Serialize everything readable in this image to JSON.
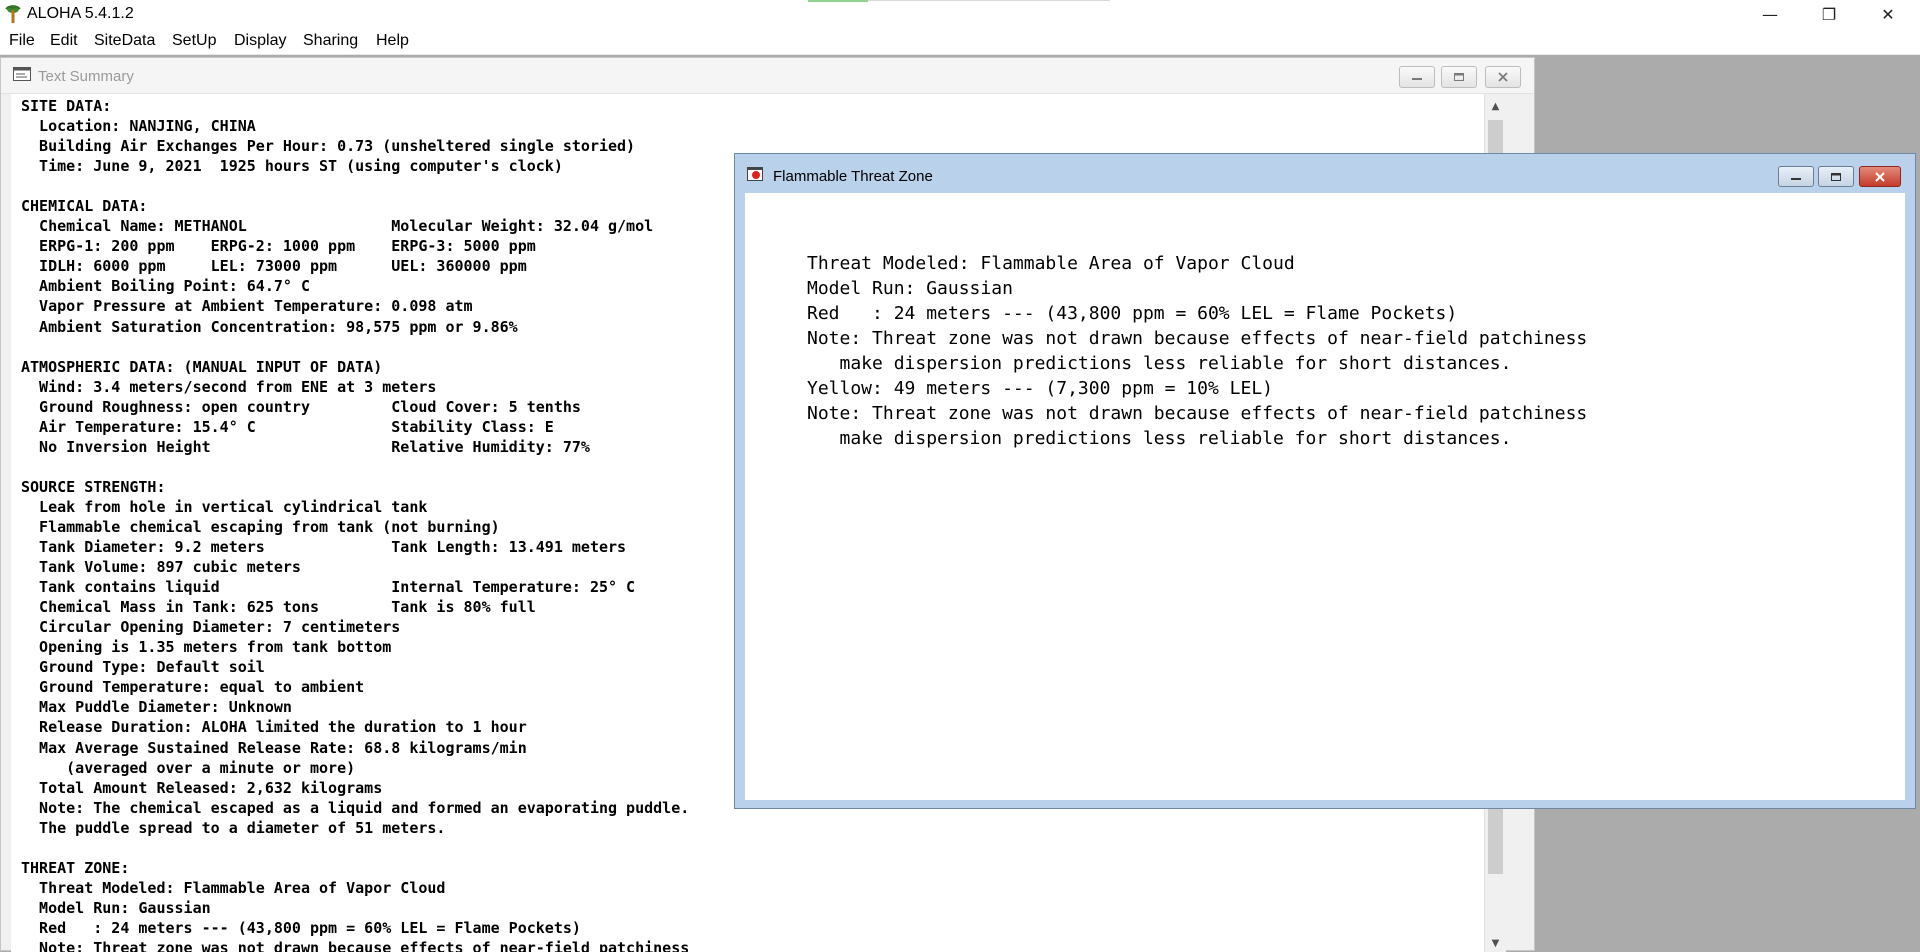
{
  "app": {
    "title": "ALOHA 5.4.1.2",
    "window_controls": {
      "minimize": "—",
      "maximize": "❐",
      "close": "✕"
    }
  },
  "menu": [
    "File",
    "Edit",
    "SiteData",
    "SetUp",
    "Display",
    "Sharing",
    "Help"
  ],
  "text_summary": {
    "title": "Text Summary",
    "lines": [
      "SITE DATA:",
      "  Location: NANJING, CHINA",
      "  Building Air Exchanges Per Hour: 0.73 (unsheltered single storied)",
      "  Time: June 9, 2021  1925 hours ST (using computer's clock)",
      "",
      "CHEMICAL DATA:",
      "  Chemical Name: METHANOL                Molecular Weight: 32.04 g/mol",
      "  ERPG-1: 200 ppm    ERPG-2: 1000 ppm    ERPG-3: 5000 ppm",
      "  IDLH: 6000 ppm     LEL: 73000 ppm      UEL: 360000 ppm",
      "  Ambient Boiling Point: 64.7° C",
      "  Vapor Pressure at Ambient Temperature: 0.098 atm",
      "  Ambient Saturation Concentration: 98,575 ppm or 9.86%",
      "",
      "ATMOSPHERIC DATA: (MANUAL INPUT OF DATA)",
      "  Wind: 3.4 meters/second from ENE at 3 meters",
      "  Ground Roughness: open country         Cloud Cover: 5 tenths",
      "  Air Temperature: 15.4° C               Stability Class: E",
      "  No Inversion Height                    Relative Humidity: 77%",
      "",
      "SOURCE STRENGTH:",
      "  Leak from hole in vertical cylindrical tank",
      "  Flammable chemical escaping from tank (not burning)",
      "  Tank Diameter: 9.2 meters              Tank Length: 13.491 meters",
      "  Tank Volume: 897 cubic meters",
      "  Tank contains liquid                   Internal Temperature: 25° C",
      "  Chemical Mass in Tank: 625 tons        Tank is 80% full",
      "  Circular Opening Diameter: 7 centimeters",
      "  Opening is 1.35 meters from tank bottom",
      "  Ground Type: Default soil",
      "  Ground Temperature: equal to ambient",
      "  Max Puddle Diameter: Unknown",
      "  Release Duration: ALOHA limited the duration to 1 hour",
      "  Max Average Sustained Release Rate: 68.8 kilograms/min",
      "     (averaged over a minute or more)",
      "  Total Amount Released: 2,632 kilograms",
      "  Note: The chemical escaped as a liquid and formed an evaporating puddle.",
      "  The puddle spread to a diameter of 51 meters.",
      "",
      "THREAT ZONE:",
      "  Threat Modeled: Flammable Area of Vapor Cloud",
      "  Model Run: Gaussian",
      "  Red   : 24 meters --- (43,800 ppm = 60% LEL = Flame Pockets)",
      "  Note: Threat zone was not drawn because effects of near-field patchiness"
    ]
  },
  "threat_zone": {
    "title": "Flammable Threat Zone",
    "lines": [
      "Threat Modeled: Flammable Area of Vapor Cloud",
      "Model Run: Gaussian",
      "Red   : 24 meters --- (43,800 ppm = 60% LEL = Flame Pockets)",
      "Note: Threat zone was not drawn because effects of near-field patchiness",
      "   make dispersion predictions less reliable for short distances.",
      "Yellow: 49 meters --- (7,300 ppm = 10% LEL)",
      "Note: Threat zone was not drawn because effects of near-field patchiness",
      "   make dispersion predictions less reliable for short distances."
    ]
  }
}
